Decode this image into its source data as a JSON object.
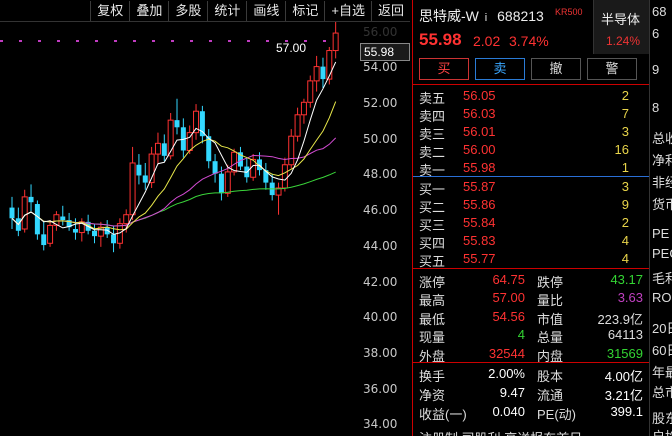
{
  "toolbar": {
    "buttons": [
      "复权",
      "叠加",
      "多股",
      "统计",
      "画线",
      "标记",
      "+自选",
      "返回"
    ]
  },
  "chart": {
    "y_ticks": [
      "56.00",
      "54.00",
      "52.00",
      "50.00",
      "48.00",
      "46.00",
      "44.00",
      "42.00",
      "40.00",
      "38.00",
      "36.00",
      "34.00"
    ],
    "current_price_tag": "55.98",
    "high_label": "57.00",
    "colors": {
      "up": "#ff3232",
      "down": "#33d8ff",
      "ma5": "#ffffff",
      "ma10": "#e8e84a",
      "ma20": "#d24bd2",
      "ma60": "#3ad43a"
    }
  },
  "chart_data": {
    "type": "candlestick",
    "ylim": [
      33.4,
      56.6
    ],
    "candles": [
      {
        "o": 46.2,
        "h": 46.8,
        "l": 45.0,
        "c": 45.6
      },
      {
        "o": 45.6,
        "h": 46.2,
        "l": 44.6,
        "c": 44.9
      },
      {
        "o": 45.0,
        "h": 47.2,
        "l": 44.8,
        "c": 46.8
      },
      {
        "o": 46.8,
        "h": 47.5,
        "l": 46.0,
        "c": 46.5
      },
      {
        "o": 46.4,
        "h": 46.6,
        "l": 44.4,
        "c": 44.7
      },
      {
        "o": 44.7,
        "h": 45.4,
        "l": 43.8,
        "c": 44.1
      },
      {
        "o": 44.2,
        "h": 45.5,
        "l": 44.0,
        "c": 45.2
      },
      {
        "o": 45.2,
        "h": 46.0,
        "l": 44.9,
        "c": 45.8
      },
      {
        "o": 45.7,
        "h": 46.3,
        "l": 45.2,
        "c": 45.5
      },
      {
        "o": 45.5,
        "h": 45.9,
        "l": 44.9,
        "c": 45.1
      },
      {
        "o": 45.0,
        "h": 45.6,
        "l": 44.4,
        "c": 44.8
      },
      {
        "o": 44.8,
        "h": 45.6,
        "l": 44.3,
        "c": 45.4
      },
      {
        "o": 45.4,
        "h": 45.8,
        "l": 44.7,
        "c": 44.9
      },
      {
        "o": 44.9,
        "h": 45.3,
        "l": 44.2,
        "c": 44.6
      },
      {
        "o": 44.6,
        "h": 45.4,
        "l": 44.0,
        "c": 45.1
      },
      {
        "o": 45.1,
        "h": 45.5,
        "l": 44.5,
        "c": 44.7
      },
      {
        "o": 44.7,
        "h": 45.2,
        "l": 43.7,
        "c": 44.2
      },
      {
        "o": 44.2,
        "h": 45.6,
        "l": 43.9,
        "c": 45.3
      },
      {
        "o": 45.3,
        "h": 46.1,
        "l": 44.8,
        "c": 45.8
      },
      {
        "o": 45.8,
        "h": 49.6,
        "l": 45.5,
        "c": 48.7
      },
      {
        "o": 48.6,
        "h": 49.2,
        "l": 47.5,
        "c": 48.0
      },
      {
        "o": 48.0,
        "h": 48.7,
        "l": 47.2,
        "c": 47.6
      },
      {
        "o": 47.6,
        "h": 49.6,
        "l": 47.3,
        "c": 49.2
      },
      {
        "o": 49.2,
        "h": 50.4,
        "l": 48.6,
        "c": 49.8
      },
      {
        "o": 49.8,
        "h": 50.3,
        "l": 48.8,
        "c": 49.1
      },
      {
        "o": 49.1,
        "h": 51.5,
        "l": 48.9,
        "c": 51.1
      },
      {
        "o": 51.1,
        "h": 52.3,
        "l": 50.3,
        "c": 50.7
      },
      {
        "o": 50.7,
        "h": 51.2,
        "l": 49.0,
        "c": 49.4
      },
      {
        "o": 49.4,
        "h": 50.8,
        "l": 49.2,
        "c": 50.4
      },
      {
        "o": 50.4,
        "h": 52.0,
        "l": 50.0,
        "c": 51.6
      },
      {
        "o": 51.6,
        "h": 51.9,
        "l": 49.8,
        "c": 50.2
      },
      {
        "o": 50.2,
        "h": 50.6,
        "l": 48.4,
        "c": 48.8
      },
      {
        "o": 48.8,
        "h": 49.2,
        "l": 47.6,
        "c": 48.1
      },
      {
        "o": 48.1,
        "h": 48.5,
        "l": 46.6,
        "c": 47.0
      },
      {
        "o": 47.0,
        "h": 48.6,
        "l": 46.8,
        "c": 48.2
      },
      {
        "o": 48.2,
        "h": 49.5,
        "l": 48.0,
        "c": 49.3
      },
      {
        "o": 49.3,
        "h": 49.6,
        "l": 48.3,
        "c": 48.5
      },
      {
        "o": 48.5,
        "h": 49.0,
        "l": 47.6,
        "c": 47.9
      },
      {
        "o": 47.9,
        "h": 49.2,
        "l": 47.7,
        "c": 48.9
      },
      {
        "o": 48.9,
        "h": 49.3,
        "l": 48.0,
        "c": 48.3
      },
      {
        "o": 48.3,
        "h": 48.7,
        "l": 47.2,
        "c": 47.6
      },
      {
        "o": 47.6,
        "h": 48.1,
        "l": 46.6,
        "c": 46.9
      },
      {
        "o": 46.9,
        "h": 47.6,
        "l": 45.8,
        "c": 47.3
      },
      {
        "o": 47.3,
        "h": 49.0,
        "l": 47.1,
        "c": 48.6
      },
      {
        "o": 48.6,
        "h": 50.6,
        "l": 48.4,
        "c": 50.2
      },
      {
        "o": 50.2,
        "h": 51.8,
        "l": 49.9,
        "c": 51.4
      },
      {
        "o": 51.4,
        "h": 52.3,
        "l": 50.9,
        "c": 52.1
      },
      {
        "o": 52.1,
        "h": 53.6,
        "l": 51.8,
        "c": 53.3
      },
      {
        "o": 53.3,
        "h": 54.7,
        "l": 52.7,
        "c": 54.1
      },
      {
        "o": 54.1,
        "h": 54.6,
        "l": 52.9,
        "c": 53.4
      },
      {
        "o": 53.4,
        "h": 55.2,
        "l": 53.1,
        "c": 55.0
      },
      {
        "o": 55.0,
        "h": 57.0,
        "l": 54.56,
        "c": 55.98
      }
    ]
  },
  "panel": {
    "name": "思特威-W",
    "info_mark": "i",
    "code": "688213",
    "kr_badge": "KR500",
    "sector": "半导体",
    "sector_pct": "1.24%",
    "price": "55.98",
    "change": "2.02",
    "change_pct": "3.74%",
    "buttons": {
      "buy": "买",
      "sell": "卖",
      "cancel": "撤",
      "alert": "警"
    },
    "asks": [
      {
        "label": "卖五",
        "price": "56.05",
        "vol": "2"
      },
      {
        "label": "卖四",
        "price": "56.03",
        "vol": "7"
      },
      {
        "label": "卖三",
        "price": "56.01",
        "vol": "3"
      },
      {
        "label": "卖二",
        "price": "56.00",
        "vol": "16"
      },
      {
        "label": "卖一",
        "price": "55.98",
        "vol": "1"
      }
    ],
    "bids": [
      {
        "label": "买一",
        "price": "55.87",
        "vol": "3"
      },
      {
        "label": "买二",
        "price": "55.86",
        "vol": "9"
      },
      {
        "label": "买三",
        "price": "55.84",
        "vol": "2"
      },
      {
        "label": "买四",
        "price": "55.83",
        "vol": "4"
      },
      {
        "label": "买五",
        "price": "55.77",
        "vol": "4"
      }
    ],
    "stats": [
      {
        "k1": "涨停",
        "v1": "64.75",
        "c1": "#ff3232",
        "k2": "跌停",
        "v2": "43.17",
        "c2": "#33d433"
      },
      {
        "k1": "最高",
        "v1": "57.00",
        "c1": "#ff3232",
        "k2": "量比",
        "v2": "3.63",
        "c2": "#c040c0"
      },
      {
        "k1": "最低",
        "v1": "54.56",
        "c1": "#ff3232",
        "k2": "市值",
        "v2": "223.9亿",
        "c2": "#dddddd"
      },
      {
        "k1": "现量",
        "v1": "4",
        "c1": "#33d433",
        "k2": "总量",
        "v2": "64113",
        "c2": "#dddddd"
      },
      {
        "k1": "外盘",
        "v1": "32544",
        "c1": "#ff3232",
        "k2": "内盘",
        "v2": "31569",
        "c2": "#33d433"
      }
    ],
    "stats2": [
      {
        "k1": "换手",
        "v1": "2.00%",
        "k2": "股本",
        "v2": "4.00亿"
      },
      {
        "k1": "净资",
        "v1": "9.47",
        "k2": "流通",
        "v2": "3.21亿"
      },
      {
        "k1": "收益(一)",
        "v1": "0.040",
        "k2": "PE(动)",
        "v2": "399.1"
      }
    ],
    "footer_partial": "注册制 司股利 高送报东首日"
  },
  "strip": {
    "labels": [
      "68",
      "6",
      "9",
      "8",
      "总收",
      "净利",
      "非经",
      "货币",
      "PE",
      "PEG",
      "毛利",
      "ROE",
      "20日",
      "60日",
      "年最",
      "总市",
      "股东",
      "户均"
    ]
  }
}
